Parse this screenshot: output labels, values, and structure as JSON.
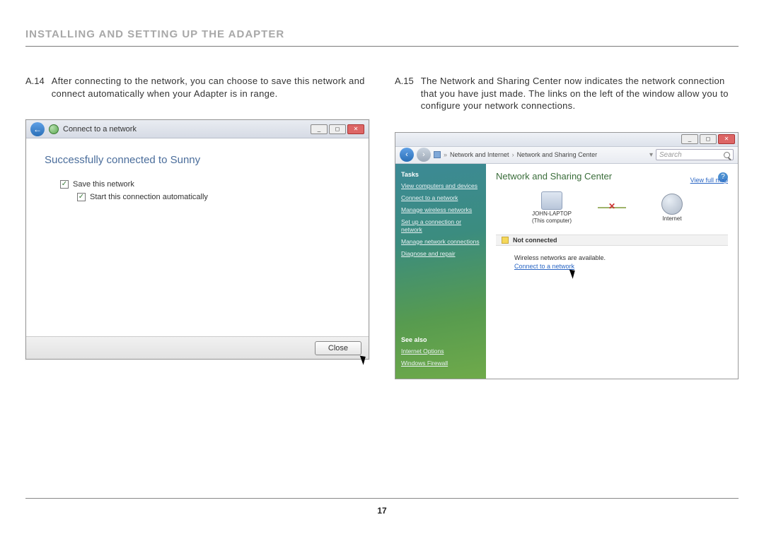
{
  "page": {
    "section_title": "INSTALLING AND SETTING UP THE ADAPTER",
    "number": "17"
  },
  "left": {
    "step_id": "A.14",
    "step_text": "After connecting to the network, you can choose to save this network and connect automatically when your Adapter is in range.",
    "window": {
      "title": "Connect to a network",
      "success": "Successfully connected to Sunny",
      "save_label": "Save this network",
      "auto_label": "Start this connection automatically",
      "close": "Close"
    }
  },
  "right": {
    "step_id": "A.15",
    "step_text": "The Network and Sharing Center now indicates the network connection that you have just made. The links on the left of the window allow you to configure your network connections.",
    "window": {
      "breadcrumb_1": "Network and Internet",
      "breadcrumb_2": "Network and Sharing Center",
      "search_placeholder": "Search",
      "nsc_title": "Network and Sharing Center",
      "view_map": "View full map",
      "node1_a": "JOHN-LAPTOP",
      "node1_b": "(This computer)",
      "node2": "Internet",
      "not_connected": "Not connected",
      "avail": "Wireless networks are available.",
      "connect_link": "Connect to a network",
      "sidebar": {
        "tasks_head": "Tasks",
        "links": [
          "View computers and devices",
          "Connect to a network",
          "Manage wireless networks",
          "Set up a connection or network",
          "Manage network connections",
          "Diagnose and repair"
        ],
        "seealso_head": "See also",
        "seealso": [
          "Internet Options",
          "Windows Firewall"
        ]
      }
    }
  }
}
